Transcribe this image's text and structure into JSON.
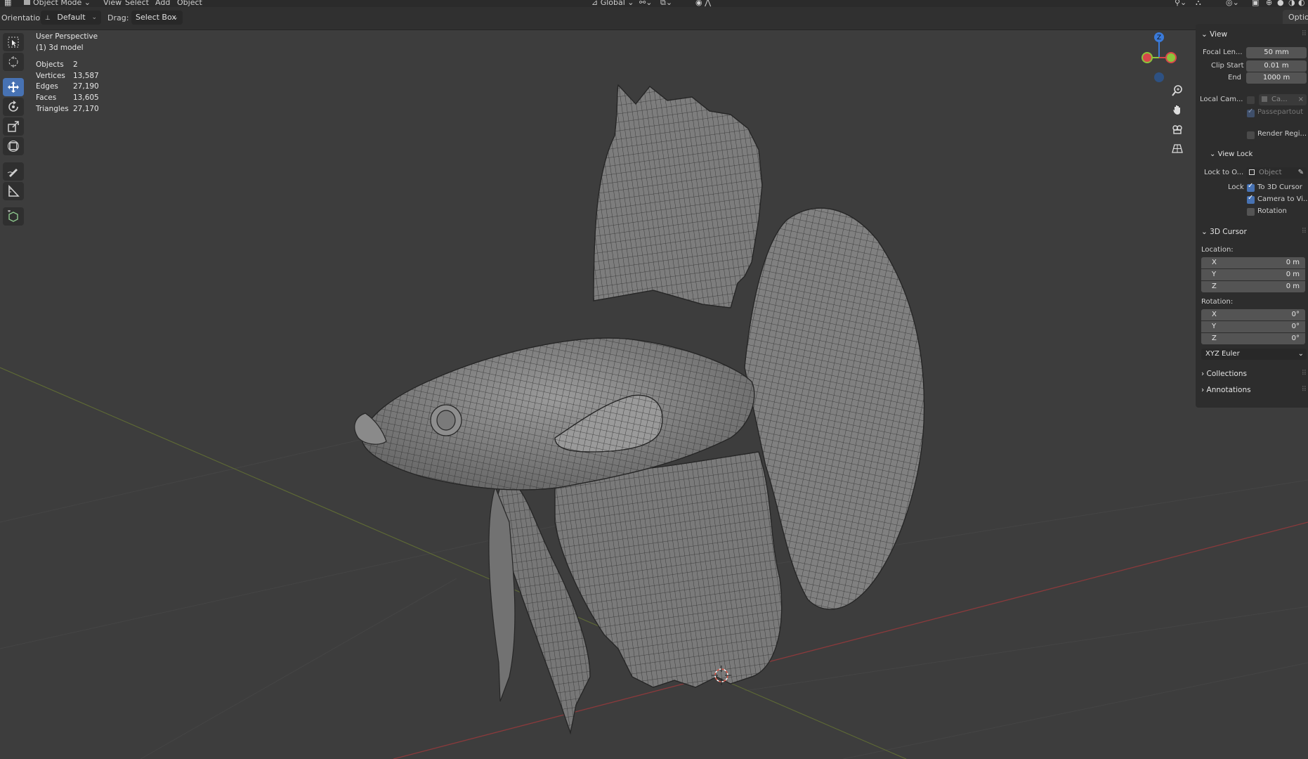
{
  "menubar": {
    "mode": "Object Mode",
    "menus": [
      "View",
      "Select",
      "Add",
      "Object"
    ],
    "transform_space": "Global"
  },
  "header": {
    "orientation_label": "Orientation:",
    "orientation_value": "Default",
    "drag_label": "Drag:",
    "drag_value": "Select Box",
    "options_tab": "Optio"
  },
  "viewport": {
    "perspective": "User Perspective",
    "object_name": "(1) 3d model",
    "stats": [
      {
        "label": "Objects",
        "value": "2"
      },
      {
        "label": "Vertices",
        "value": "13,587"
      },
      {
        "label": "Edges",
        "value": "27,190"
      },
      {
        "label": "Faces",
        "value": "13,605"
      },
      {
        "label": "Triangles",
        "value": "27,170"
      }
    ],
    "gizmo_axis_label": "Z"
  },
  "toolbar": {
    "tools": [
      "select-box",
      "cursor",
      "move",
      "rotate",
      "scale",
      "transform",
      "annotate",
      "measure",
      "add-cube"
    ],
    "active_tool": "move"
  },
  "npanel": {
    "view": {
      "title": "View",
      "focal_label": "Focal Len...",
      "focal_value": "50 mm",
      "clip_start_label": "Clip Start",
      "clip_start_value": "0.01 m",
      "end_label": "End",
      "end_value": "1000 m",
      "local_camera_label": "Local Cam...",
      "local_camera_value": "Ca...",
      "passepartout_label": "Passepartout",
      "render_region_label": "Render Regi..."
    },
    "view_lock": {
      "title": "View Lock",
      "lock_to_label": "Lock to O...",
      "lock_to_value": "Object",
      "lock_label": "Lock",
      "to_cursor_label": "To 3D Cursor",
      "camera_to_view_label": "Camera to Vi...",
      "rotation_label": "Rotation"
    },
    "cursor": {
      "title": "3D Cursor",
      "location_label": "Location:",
      "location": [
        {
          "axis": "X",
          "value": "0 m"
        },
        {
          "axis": "Y",
          "value": "0 m"
        },
        {
          "axis": "Z",
          "value": "0 m"
        }
      ],
      "rotation_label": "Rotation:",
      "rotation": [
        {
          "axis": "X",
          "value": "0°"
        },
        {
          "axis": "Y",
          "value": "0°"
        },
        {
          "axis": "Z",
          "value": "0°"
        }
      ],
      "rotation_mode": "XYZ Euler"
    },
    "collections_title": "Collections",
    "annotations_title": "Annotations"
  },
  "colors": {
    "accent": "#4772b3",
    "background": "#3d3d3d",
    "axis_x": "#d9464a",
    "axis_y": "#8cc43c",
    "axis_z": "#3a7ad9"
  }
}
